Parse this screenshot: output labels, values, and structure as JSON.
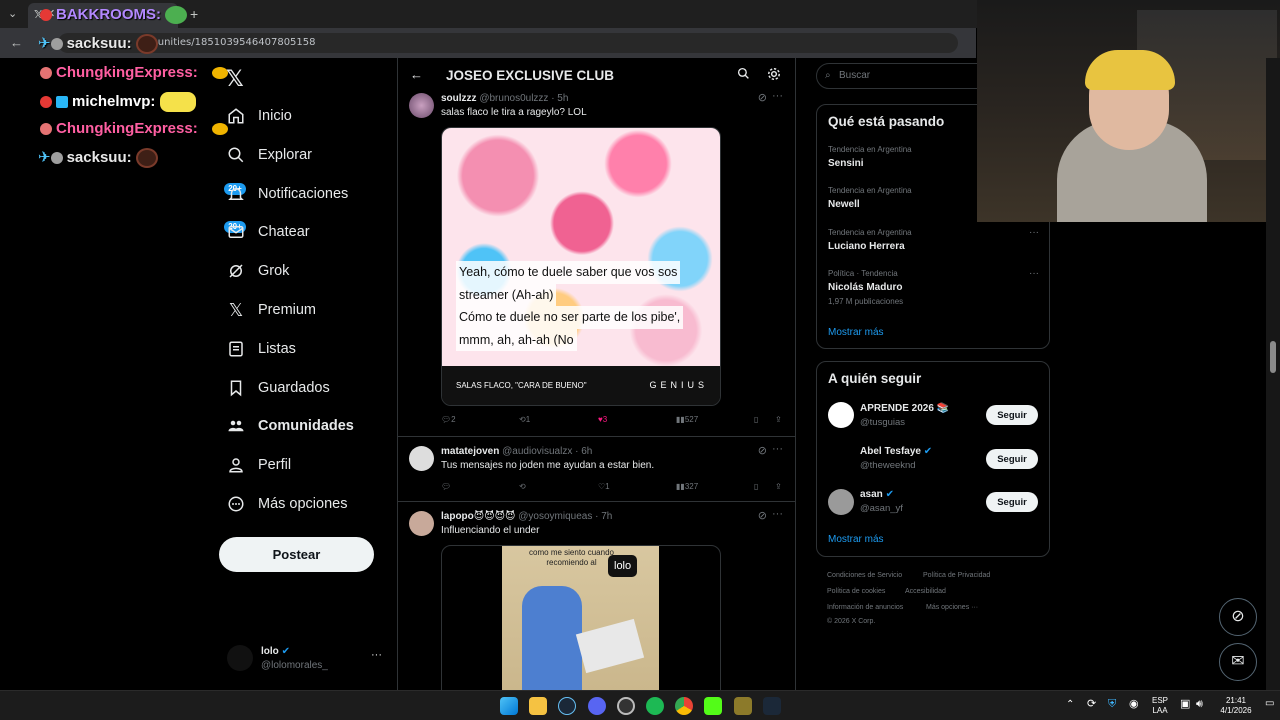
{
  "browser": {
    "tab_title": "BAKKROOMS:",
    "url": "munities/1851039546407805158"
  },
  "chat_overlay": [
    {
      "user": "BAKKROOMS:",
      "color": "#b388ff"
    },
    {
      "user": "sacksuu:",
      "color": "#e8e8e8"
    },
    {
      "user": "ChungkingExpress:",
      "color": "#ff5fa2"
    },
    {
      "user": "michelmvp:",
      "color": "#ffffff"
    },
    {
      "user": "ChungkingExpress:",
      "color": "#ff5fa2"
    },
    {
      "user": "sacksuu:",
      "color": "#e8e8e8"
    }
  ],
  "nav": {
    "items": [
      {
        "label": "Inicio",
        "icon": "home-icon"
      },
      {
        "label": "Explorar",
        "icon": "search-icon"
      },
      {
        "label": "Notificaciones",
        "icon": "bell-icon",
        "badge": "20+"
      },
      {
        "label": "Chatear",
        "icon": "mail-icon",
        "badge": "20+"
      },
      {
        "label": "Grok",
        "icon": "grok-icon"
      },
      {
        "label": "Premium",
        "icon": "x-icon"
      },
      {
        "label": "Listas",
        "icon": "list-icon"
      },
      {
        "label": "Guardados",
        "icon": "bookmark-icon"
      },
      {
        "label": "Comunidades",
        "icon": "communities-icon"
      },
      {
        "label": "Perfil",
        "icon": "person-icon"
      },
      {
        "label": "Más opciones",
        "icon": "more-circle-icon"
      }
    ],
    "post_label": "Postear",
    "profile": {
      "name": "lolo",
      "handle": "@lolomorales_"
    }
  },
  "main": {
    "title": "JOSEO EXCLUSIVE CLUB",
    "tweets": [
      {
        "name": "soulzzz",
        "handle": "@brunos0ulzzz",
        "time": "· 5h",
        "text": "salas flaco le tira a rageylo? LOL",
        "media": {
          "lyrics_1": "Yeah, cómo te duele saber que vos sos",
          "lyrics_2": "streamer (Ah-ah)",
          "lyrics_3": "Cómo te duele no ser parte de los pibe',",
          "lyrics_4": "mmm, ah, ah-ah (No",
          "song": "SALAS FLACO, \"CARA DE BUENO\"",
          "brand": "GENIUS"
        },
        "replies": "2",
        "reposts": "1",
        "likes": "3",
        "views": "527"
      },
      {
        "name": "matatejoven",
        "handle": "@audiovisualzx",
        "time": "· 6h",
        "text": "Tus mensajes no joden me ayudan a estar bien.",
        "replies": "",
        "reposts": "",
        "likes": "1",
        "views": "327"
      },
      {
        "name": "lapopo😈😈😈😈",
        "handle": "@yosoymiqueas",
        "time": "· 7h",
        "text": "Influenciando el under",
        "media": {
          "caption": "como me siento cuando recomiendo al",
          "tag": "lolo"
        }
      }
    ]
  },
  "sidebar": {
    "search_placeholder": "Buscar",
    "trends_title": "Qué está pasando",
    "trends": [
      {
        "meta": "Tendencia en Argentina",
        "name": "Sensini"
      },
      {
        "meta": "Tendencia en Argentina",
        "name": "Newell"
      },
      {
        "meta": "Tendencia en Argentina",
        "name": "Luciano Herrera"
      },
      {
        "meta": "Política · Tendencia",
        "name": "Nicolás Maduro",
        "extra": "1,97 M publicaciones"
      }
    ],
    "show_more": "Mostrar más",
    "follow_title": "A quién seguir",
    "follow": [
      {
        "name": "APRENDE 2026 📚",
        "handle": "@tusguias",
        "button": "Seguir"
      },
      {
        "name": "Abel Tesfaye",
        "handle": "@theweeknd",
        "button": "Seguir"
      },
      {
        "name": "asan",
        "handle": "@asan_yf",
        "button": "Seguir"
      }
    ],
    "footer": {
      "l1": "Condiciones de Servicio",
      "l2": "Política de Privacidad",
      "l3": "Política de cookies",
      "l4": "Accesibilidad",
      "l5": "Información de anuncios",
      "l6": "Más opciones ···",
      "copyright": "© 2026 X Corp."
    }
  },
  "taskbar": {
    "lang_1": "ESP",
    "lang_2": "LAA",
    "time": "21:41",
    "date": "4/1/2026"
  }
}
